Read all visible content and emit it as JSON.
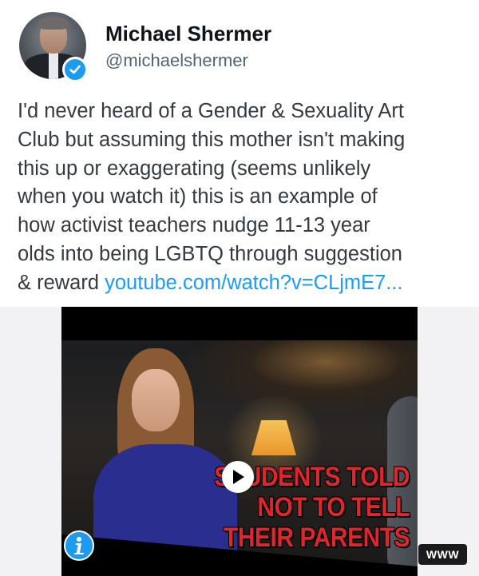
{
  "author": {
    "name": "Michael Shermer",
    "handle": "@michaelshermer",
    "verified": true
  },
  "tweet": {
    "lines": [
      "I'd never heard of a Gender & Sexuality Art",
      "Club but assuming this mother isn't making",
      "this up or exaggerating (seems unlikely",
      "when you watch it) this is an example of",
      "how activist teachers nudge 11-13 year",
      "olds into being LGBTQ through suggestion",
      "& reward "
    ],
    "link_text": "youtube.com/watch?v=CLjmE7..."
  },
  "video": {
    "overlay_lines": [
      "STUDENTS TOLD",
      "NOT TO TELL",
      "THEIR PARENTS"
    ],
    "badge": "WWW",
    "icons": {
      "play": "play-icon",
      "logo": "channel-logo-icon"
    }
  },
  "colors": {
    "link": "#1d9bf0",
    "verified": "#1d9bf0",
    "overlay_text": "#e0262c"
  }
}
